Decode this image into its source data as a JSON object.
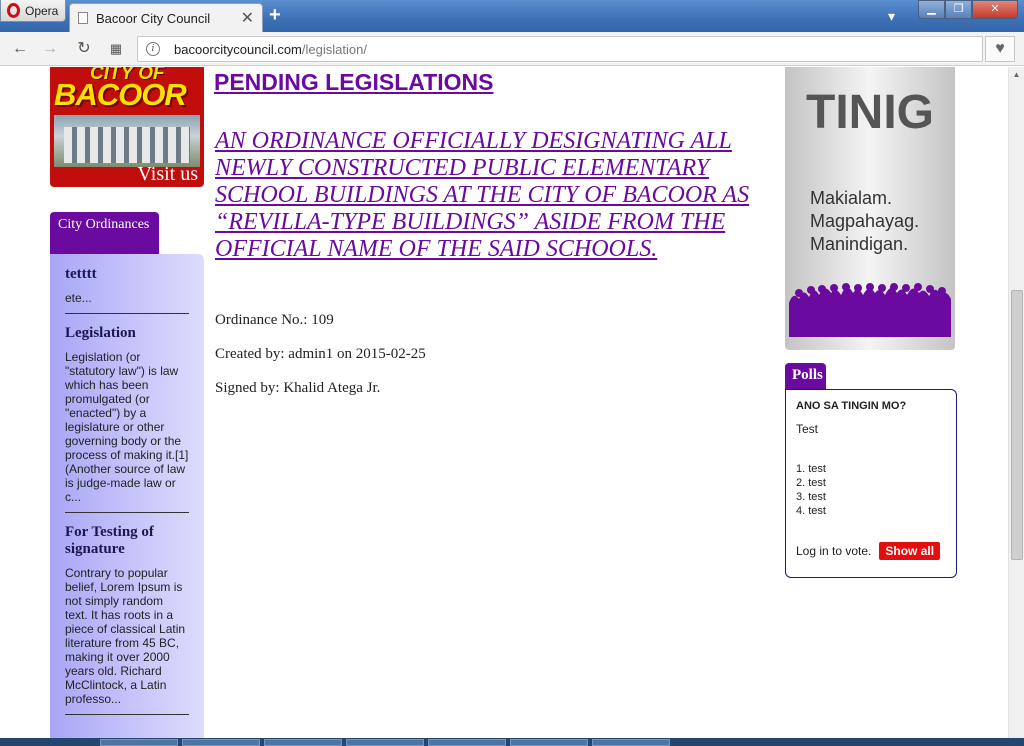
{
  "browser": {
    "menu_label": "Opera",
    "tab_title": "Bacoor City Council",
    "tab_close": "✕",
    "new_tab": "+",
    "url_host": "bacoorcitycouncil.com",
    "url_path": "/legislation/"
  },
  "logo": {
    "line1": "CITY OF",
    "line2": "BACOOR",
    "visit": "Visit us"
  },
  "sidebar": {
    "tab_label": "City Ordinances",
    "items": [
      {
        "title": "tetttt",
        "excerpt": "ete..."
      },
      {
        "title": "Legislation",
        "excerpt": "Legislation (or \"statutory law\") is law which has been promulgated (or \"enacted\") by a legislature or other governing body or the process of making it.[1] (Another source of law is judge-made law or c..."
      },
      {
        "title": "For Testing of signature",
        "excerpt": "Contrary to popular belief, Lorem Ipsum is not simply random text. It has roots in a piece of classical Latin literature from 45 BC, making it over 2000 years old. Richard McClintock, a Latin professo..."
      }
    ]
  },
  "main": {
    "page_title": "PENDING LEGISLATIONS",
    "ordinance_title": "AN ORDINANCE OFFICIALLY DESIGNATING ALL NEWLY CONSTRUCTED PUBLIC ELEMENTARY SCHOOL BUILDINGS AT THE CITY OF BACOOR AS “REVILLA-TYPE BUILDINGS” ASIDE FROM THE OFFICIAL NAME OF THE SAID SCHOOLS.",
    "ordinance_no": "Ordinance No.: 109",
    "created_by": "Created by: admin1 on 2015-02-25",
    "signed_by": "Signed by: Khalid Atega Jr."
  },
  "banner": {
    "title": "TINIG",
    "lines": [
      "Makialam.",
      "Magpahayag.",
      "Manindigan."
    ]
  },
  "polls": {
    "tab_label": "Polls",
    "question": "ANO SA TINGIN MO?",
    "description": "Test",
    "options": [
      "1. test",
      "2. test",
      "3. test",
      "4. test"
    ],
    "login_text": "Log in to vote.",
    "show_all": "Show all"
  },
  "colors": {
    "brand_purple": "#6a0a9e",
    "button_red": "#e40e0e",
    "sidebar_lavender": "#c9c8fb"
  }
}
